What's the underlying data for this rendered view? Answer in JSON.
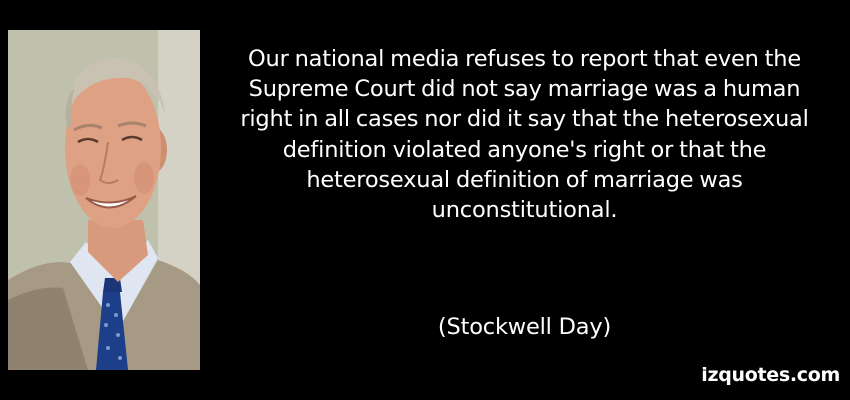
{
  "quote": {
    "lines": [
      "Our national media refuses to report that even the",
      "Supreme Court did not say marriage was a human",
      "right in all cases nor did it say that the heterosexual",
      "definition violated anyone's right or that the",
      "heterosexual definition of marriage was",
      "unconstitutional."
    ],
    "author": "(Stockwell Day)"
  },
  "watermark": "izquotes.com",
  "colors": {
    "background": "#000000",
    "text": "#ffffff"
  }
}
